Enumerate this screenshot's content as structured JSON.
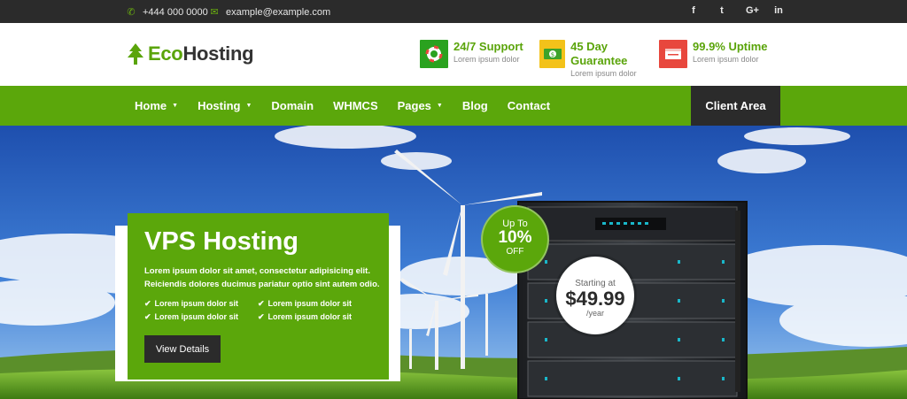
{
  "topbar": {
    "phone": "+444 000 0000",
    "email": "example@example.com",
    "socials": [
      "f",
      "t",
      "G+",
      "in"
    ]
  },
  "header": {
    "brand_part1": "Eco",
    "brand_part2": "Hosting",
    "features": [
      {
        "title": "24/7 Support",
        "sub": "Lorem ipsum dolor",
        "color": "#2aa21f",
        "icon": "lifebuoy-icon"
      },
      {
        "title": "45 Day Guarantee",
        "sub": "Lorem ipsum dolor",
        "color": "#f3c21a",
        "icon": "money-icon"
      },
      {
        "title": "99.9% Uptime",
        "sub": "Lorem ipsum dolor",
        "color": "#e8473d",
        "icon": "window-icon"
      }
    ]
  },
  "nav": {
    "items": [
      {
        "label": "Home",
        "dropdown": true
      },
      {
        "label": "Hosting",
        "dropdown": true
      },
      {
        "label": "Domain",
        "dropdown": false
      },
      {
        "label": "WHMCS",
        "dropdown": false
      },
      {
        "label": "Pages",
        "dropdown": true
      },
      {
        "label": "Blog",
        "dropdown": false
      },
      {
        "label": "Contact",
        "dropdown": false
      }
    ],
    "client_area": "Client Area"
  },
  "hero": {
    "title": "VPS Hosting",
    "description": "Lorem ipsum dolor sit amet, consectetur adipisicing elit. Reiciendis dolores ducimus pariatur optio sint autem odio.",
    "checks": [
      "Lorem ipsum dolor sit",
      "Lorem ipsum dolor sit",
      "Lorem ipsum dolor sit",
      "Lorem ipsum dolor sit"
    ],
    "button": "View Details",
    "discount": {
      "line1": "Up To",
      "line2": "10%",
      "line3": "OFF"
    },
    "price": {
      "line1": "Starting at",
      "amount": "$49.99",
      "period": "/year"
    }
  },
  "colors": {
    "accent": "#5ba70b",
    "dark": "#2b2b2b"
  }
}
